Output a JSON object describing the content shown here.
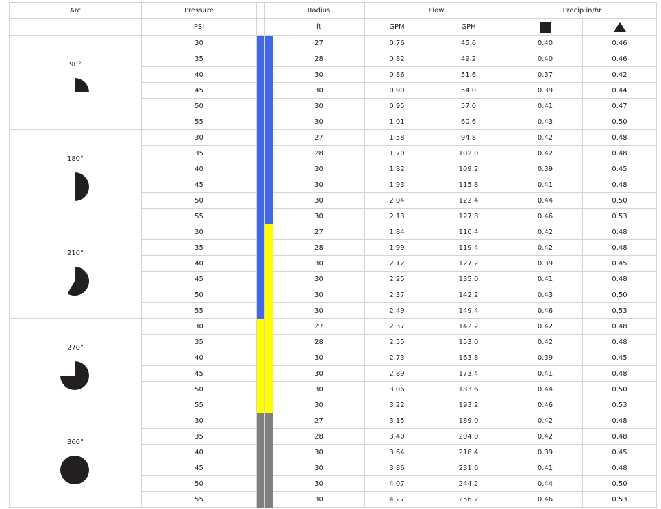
{
  "headers": {
    "arc": "Arc",
    "pressure": "Pressure",
    "radius": "Radius",
    "flow": "Flow",
    "precip": "Precip in/hr"
  },
  "units": {
    "pressure": "PSI",
    "radius": "ft",
    "gpm": "GPM",
    "gph": "GPH"
  },
  "precip_icons": [
    "square-spacing-icon",
    "triangle-spacing-icon"
  ],
  "colors": {
    "blue": "#4169e1",
    "yellow": "#ffff00",
    "gray": "#808080",
    "icon": "#231f20"
  },
  "groups": [
    {
      "arc": "90°",
      "icon": "arc-90-icon",
      "arc_degrees": 90,
      "band_colors": [
        "blue",
        "blue"
      ],
      "rows": [
        {
          "psi": "30",
          "radius": "27",
          "gpm": "0.76",
          "gph": "45.6",
          "square": "0.40",
          "triangle": "0.46"
        },
        {
          "psi": "35",
          "radius": "28",
          "gpm": "0.82",
          "gph": "49.2",
          "square": "0.40",
          "triangle": "0.46"
        },
        {
          "psi": "40",
          "radius": "30",
          "gpm": "0.86",
          "gph": "51.6",
          "square": "0.37",
          "triangle": "0.42"
        },
        {
          "psi": "45",
          "radius": "30",
          "gpm": "0.90",
          "gph": "54.0",
          "square": "0.39",
          "triangle": "0.44"
        },
        {
          "psi": "50",
          "radius": "30",
          "gpm": "0.95",
          "gph": "57.0",
          "square": "0.41",
          "triangle": "0.47"
        },
        {
          "psi": "55",
          "radius": "30",
          "gpm": "1.01",
          "gph": "60.6",
          "square": "0.43",
          "triangle": "0.50"
        }
      ]
    },
    {
      "arc": "180°",
      "icon": "arc-180-icon",
      "arc_degrees": 180,
      "band_colors": [
        "blue",
        "blue"
      ],
      "rows": [
        {
          "psi": "30",
          "radius": "27",
          "gpm": "1.58",
          "gph": "94.8",
          "square": "0.42",
          "triangle": "0.48"
        },
        {
          "psi": "35",
          "radius": "28",
          "gpm": "1.70",
          "gph": "102.0",
          "square": "0.42",
          "triangle": "0.48"
        },
        {
          "psi": "40",
          "radius": "30",
          "gpm": "1.82",
          "gph": "109.2",
          "square": "0.39",
          "triangle": "0.45"
        },
        {
          "psi": "45",
          "radius": "30",
          "gpm": "1.93",
          "gph": "115.8",
          "square": "0.41",
          "triangle": "0.48"
        },
        {
          "psi": "50",
          "radius": "30",
          "gpm": "2.04",
          "gph": "122.4",
          "square": "0.44",
          "triangle": "0.50"
        },
        {
          "psi": "55",
          "radius": "30",
          "gpm": "2.13",
          "gph": "127.8",
          "square": "0.46",
          "triangle": "0.53"
        }
      ]
    },
    {
      "arc": "210°",
      "icon": "arc-210-icon",
      "arc_degrees": 210,
      "band_colors": [
        "blue",
        "yellow"
      ],
      "rows": [
        {
          "psi": "30",
          "radius": "27",
          "gpm": "1.84",
          "gph": "110.4",
          "square": "0.42",
          "triangle": "0.48"
        },
        {
          "psi": "35",
          "radius": "28",
          "gpm": "1.99",
          "gph": "119.4",
          "square": "0.42",
          "triangle": "0.48"
        },
        {
          "psi": "40",
          "radius": "30",
          "gpm": "2.12",
          "gph": "127.2",
          "square": "0.39",
          "triangle": "0.45"
        },
        {
          "psi": "45",
          "radius": "30",
          "gpm": "2.25",
          "gph": "135.0",
          "square": "0.41",
          "triangle": "0.48"
        },
        {
          "psi": "50",
          "radius": "30",
          "gpm": "2.37",
          "gph": "142.2",
          "square": "0.43",
          "triangle": "0.50"
        },
        {
          "psi": "55",
          "radius": "30",
          "gpm": "2.49",
          "gph": "149.4",
          "square": "0.46",
          "triangle": "0.53"
        }
      ]
    },
    {
      "arc": "270°",
      "icon": "arc-270-icon",
      "arc_degrees": 270,
      "band_colors": [
        "yellow",
        "yellow"
      ],
      "rows": [
        {
          "psi": "30",
          "radius": "27",
          "gpm": "2.37",
          "gph": "142.2",
          "square": "0.42",
          "triangle": "0.48"
        },
        {
          "psi": "35",
          "radius": "28",
          "gpm": "2.55",
          "gph": "153.0",
          "square": "0.42",
          "triangle": "0.48"
        },
        {
          "psi": "40",
          "radius": "30",
          "gpm": "2.73",
          "gph": "163.8",
          "square": "0.39",
          "triangle": "0.45"
        },
        {
          "psi": "45",
          "radius": "30",
          "gpm": "2.89",
          "gph": "173.4",
          "square": "0.41",
          "triangle": "0.48"
        },
        {
          "psi": "50",
          "radius": "30",
          "gpm": "3.06",
          "gph": "183.6",
          "square": "0.44",
          "triangle": "0.50"
        },
        {
          "psi": "55",
          "radius": "30",
          "gpm": "3.22",
          "gph": "193.2",
          "square": "0.46",
          "triangle": "0.53"
        }
      ]
    },
    {
      "arc": "360°",
      "icon": "arc-360-icon",
      "arc_degrees": 360,
      "band_colors": [
        "gray",
        "gray"
      ],
      "rows": [
        {
          "psi": "30",
          "radius": "27",
          "gpm": "3.15",
          "gph": "189.0",
          "square": "0.42",
          "triangle": "0.48"
        },
        {
          "psi": "35",
          "radius": "28",
          "gpm": "3.40",
          "gph": "204.0",
          "square": "0.42",
          "triangle": "0.48"
        },
        {
          "psi": "40",
          "radius": "30",
          "gpm": "3.64",
          "gph": "218.4",
          "square": "0.39",
          "triangle": "0.45"
        },
        {
          "psi": "45",
          "radius": "30",
          "gpm": "3.86",
          "gph": "231.6",
          "square": "0.41",
          "triangle": "0.48"
        },
        {
          "psi": "50",
          "radius": "30",
          "gpm": "4.07",
          "gph": "244.2",
          "square": "0.44",
          "triangle": "0.50"
        },
        {
          "psi": "55",
          "radius": "30",
          "gpm": "4.27",
          "gph": "256.2",
          "square": "0.46",
          "triangle": "0.53"
        }
      ]
    }
  ]
}
